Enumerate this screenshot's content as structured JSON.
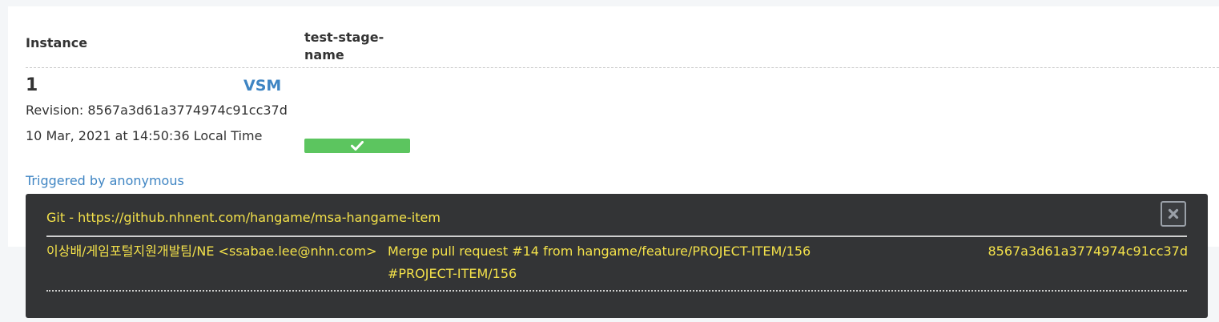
{
  "table": {
    "header_instance": "Instance",
    "header_stage": "test-stage-name"
  },
  "instance": {
    "number": "1",
    "vsm_label": "VSM",
    "revision": "Revision: 8567a3d61a3774974c91cc37d",
    "timestamp": "10 Mar, 2021 at 14:50:36 Local Time",
    "triggered_by": "Triggered by anonymous",
    "stage_status": "passed",
    "stage_color": "#5cc55f"
  },
  "popup": {
    "title": "Git - https://github.nhnent.com/hangame/msa-hangame-item",
    "author": "이상배/게임포털지원개발팀/NE <ssabae.lee@nhn.com>",
    "message": "Merge pull request #14 from hangame/feature/PROJECT-ITEM/156 #PROJECT-ITEM/156",
    "revision": "8567a3d61a3774974c91cc37d",
    "text_color": "#f3e14a",
    "background": "#333436"
  },
  "icons": {
    "stage_status": "check-icon",
    "close": "close-icon"
  }
}
